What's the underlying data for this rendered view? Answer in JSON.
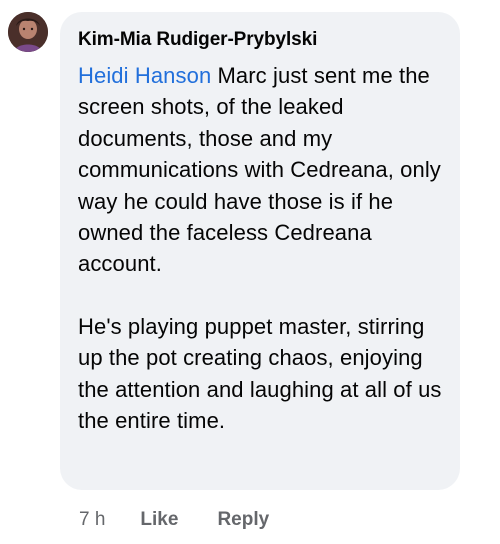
{
  "comment": {
    "author": "Kim-Mia Rudiger-Prybylski",
    "mention": "Heidi Hanson",
    "text_after_mention": " Marc just sent me the screen shots, of the leaked documents,  those and my communications with Cedreana, only way he could have those is if he owned the faceless Cedreana account.",
    "paragraph_2": "He's playing puppet master, stirring up the pot creating chaos, enjoying the attention and laughing at all of us the entire time.",
    "timestamp": "7 h",
    "like_label": "Like",
    "reply_label": "Reply"
  },
  "colors": {
    "bubble": "#f0f2f5",
    "mention": "#216fdb",
    "meta": "#65676b",
    "text": "#050505"
  }
}
